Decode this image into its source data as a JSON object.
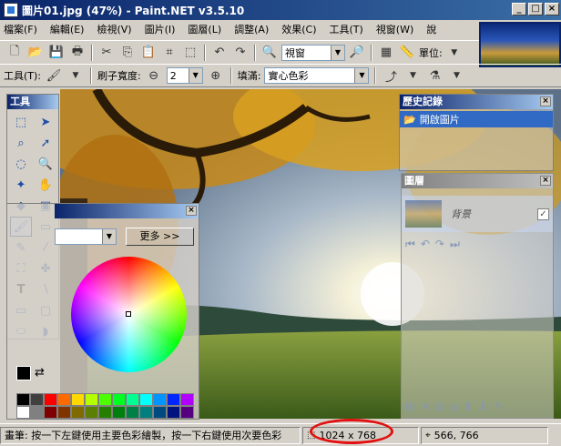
{
  "window": {
    "title": "圖片01.jpg (47%) - Paint.NET v3.5.10",
    "buttons": [
      "_",
      "□",
      "×"
    ]
  },
  "menu": [
    "檔案(F)",
    "編輯(E)",
    "檢視(V)",
    "圖片(I)",
    "圖層(L)",
    "調整(A)",
    "效果(C)",
    "工具(T)",
    "視窗(W)",
    "說"
  ],
  "toolbar1": {
    "zoom_value": "視窗",
    "units_label": "單位:"
  },
  "toolbar2": {
    "tool_label": "工具(T):",
    "brush_width_label": "刷子寬度:",
    "brush_width_value": "2",
    "fill_label": "填滿:",
    "fill_value": "實心色彩"
  },
  "tools_panel": {
    "title": "工具"
  },
  "colors_panel": {
    "more_button": "更多 >>"
  },
  "history_panel": {
    "title": "歷史記錄",
    "items": [
      "開啟圖片"
    ]
  },
  "layers_panel": {
    "title": "圖層",
    "layer_name": "背景"
  },
  "status": {
    "hint": "畫筆: 按一下左鍵使用主要色彩繪製，按一下右鍵使用次要色彩",
    "image_size": "1024 x 768",
    "cursor_position": "566, 766"
  },
  "colors": {
    "titlebar": "#0a246a",
    "highlight_oval": "#e21010",
    "palette": [
      "#000000",
      "#404040",
      "#ff0000",
      "#ff6a00",
      "#ffd800",
      "#b6ff00",
      "#4cff00",
      "#00ff21",
      "#00ff90",
      "#00ffff",
      "#0094ff",
      "#0026ff",
      "#b200ff",
      "#ffffff",
      "#808080",
      "#7f0000",
      "#7f3300",
      "#7f6a00",
      "#5b7f00",
      "#267f00",
      "#007f0e",
      "#007f46",
      "#007f7f",
      "#004a7f",
      "#00137f",
      "#57007f"
    ]
  }
}
